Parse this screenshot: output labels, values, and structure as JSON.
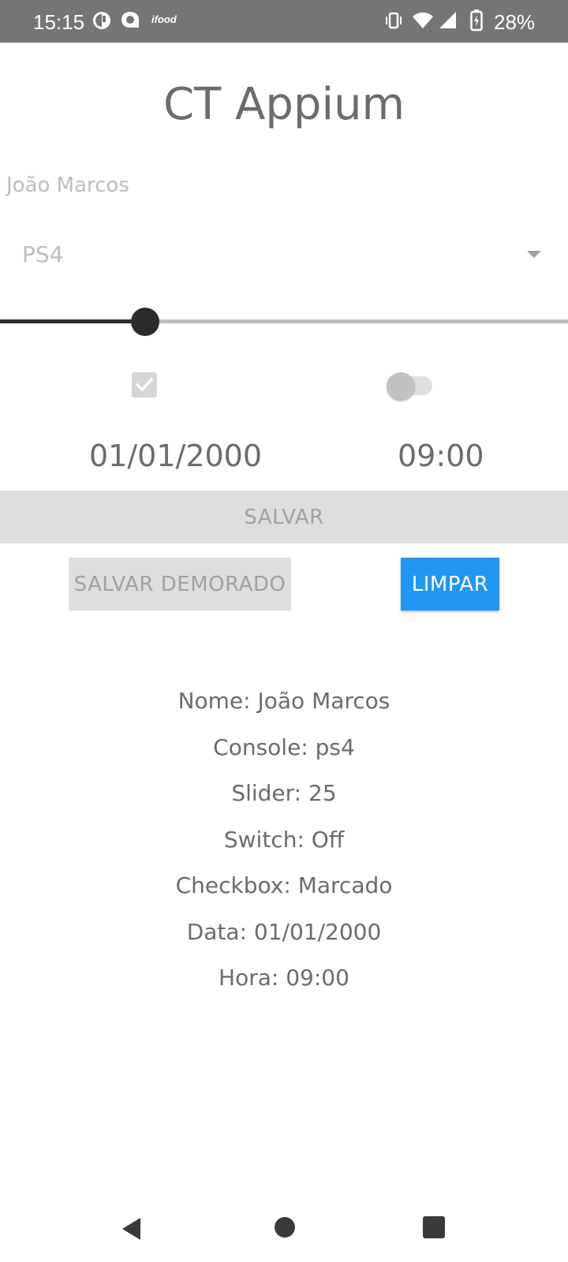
{
  "status_bar": {
    "time": "15:15",
    "battery_percent": "28%",
    "icons": [
      "app-notification-icon",
      "chat-notification-icon",
      "ifood-notification-icon",
      "vibrate-icon",
      "wifi-icon",
      "cell-signal-icon",
      "battery-charging-icon"
    ],
    "ifood_label": "ifood"
  },
  "app": {
    "title": "CT Appium"
  },
  "form": {
    "name_value": "João Marcos",
    "console_selected": "PS4",
    "slider_value": 25,
    "checkbox_checked": true,
    "switch_on": false,
    "date": "01/01/2000",
    "time": "09:00"
  },
  "buttons": {
    "save_label": "SALVAR",
    "save_delayed_label": "SALVAR DEMORADO",
    "clear_label": "LIMPAR"
  },
  "results": [
    "Nome: João Marcos",
    "Console: ps4",
    "Slider: 25",
    "Switch: Off",
    "Checkbox: Marcado",
    "Data: 01/01/2000",
    "Hora: 09:00"
  ],
  "colors": {
    "status_bar": "#757575",
    "accent": "#2196f3",
    "disabled_button": "#dedede",
    "text": "#6b6b6b"
  }
}
